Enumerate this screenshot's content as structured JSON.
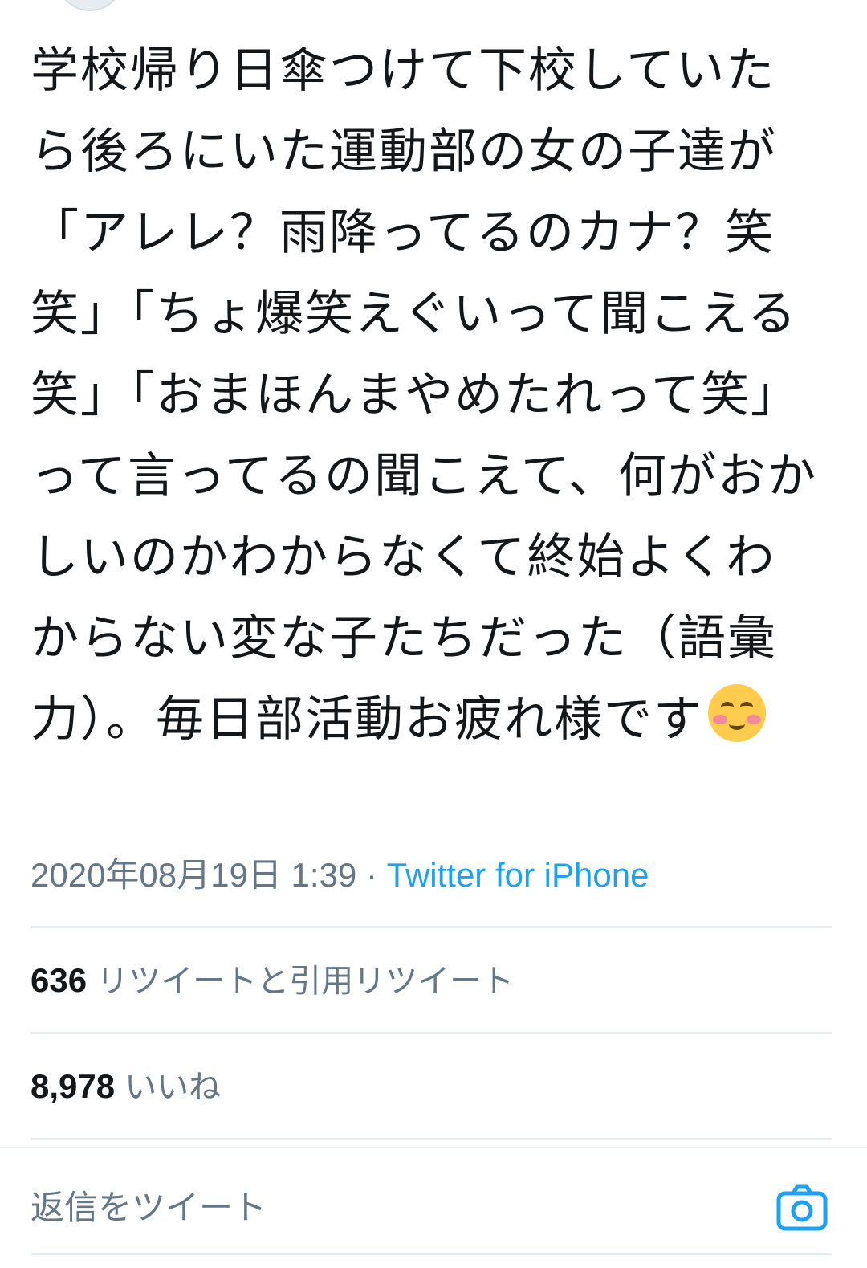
{
  "tweet": {
    "text": "学校帰り日傘つけて下校していたら後ろにいた運動部の女の子達が「アレレ？雨降ってるのカナ？笑笑」「ちょ爆笑えぐいって聞こえる笑」「おまほんまやめたれって笑」って言ってるの聞こえて、何がおかしいのかわからなくて終始よくわからない変な子たちだった（語彙力）。毎日部活動お疲れ様です",
    "emoji": "smiling-face-with-blush",
    "timestamp": "2020年08月19日 1:39",
    "separator": " · ",
    "source": "Twitter for iPhone"
  },
  "stats": {
    "retweets": {
      "count": "636",
      "label": "リツイートと引用リツイート"
    },
    "likes": {
      "count": "8,978",
      "label": "いいね"
    }
  },
  "reply": {
    "placeholder": "返信をツイート",
    "camera_icon": "camera-icon"
  },
  "colors": {
    "text": "#14171a",
    "muted": "#657786",
    "accent": "#1da1f2",
    "divider": "#e6ecf0"
  }
}
